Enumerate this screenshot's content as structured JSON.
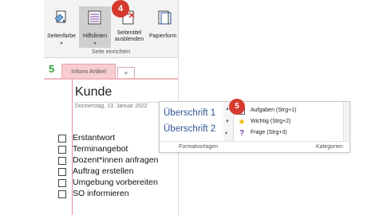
{
  "ribbon": {
    "buttons": [
      {
        "label": "Seitenfarbe",
        "icon": "page-color-icon"
      },
      {
        "label": "Hilfslinien",
        "icon": "rule-lines-icon"
      },
      {
        "label": "Seitentitel ausblenden",
        "icon": "hide-title-icon"
      },
      {
        "label": "Papierform",
        "icon": "paper-size-icon"
      }
    ],
    "group_label": "Seite einrichten",
    "step_badge": "4"
  },
  "tabs": {
    "active": "Inform Artikel",
    "add": "+",
    "notebook_icon": "5"
  },
  "page": {
    "title": "Kunde",
    "date": "Donnerstag, 13. Januar 2022",
    "todos": [
      "Erstantwort",
      "Terminangebot",
      "Dozent*innen anfragen",
      "Auftrag erstellen",
      "Umgebung vorbereiten",
      "SO informieren"
    ]
  },
  "popup": {
    "styles": [
      "Überschrift 1",
      "Überschrift 2"
    ],
    "tags": [
      {
        "icon": "checkbox-icon",
        "label": "Aufgaben (Strg+1)"
      },
      {
        "icon": "star-icon",
        "label": "Wichtig (Strg+2)"
      },
      {
        "icon": "question-icon",
        "label": "Frage (Strg+3)"
      }
    ],
    "footer_left": "Formatvorlagen",
    "footer_right": "Kategorien",
    "step_badge": "5"
  },
  "colors": {
    "accent_red": "#d53a2d",
    "tab_pink": "#f7cdd2",
    "heading_blue": "#2f5597",
    "star": "#f0b400",
    "notebook_green": "#2d9f3d"
  }
}
